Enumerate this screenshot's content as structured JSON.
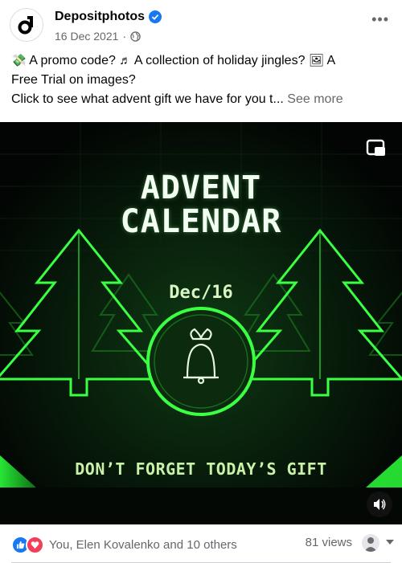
{
  "post": {
    "author": "Depositphotos",
    "date": "16 Dec 2021",
    "more_label": "•••",
    "caption": {
      "line1_a": "A promo code?",
      "line1_b": "A collection of holiday jingles?",
      "line1_c": "A",
      "line2": "Free Trial on images?",
      "line3": "Click to see what advent gift we have for you t...",
      "see_more": "See more"
    }
  },
  "media": {
    "title_line1": "ADVENT",
    "title_line2": "CALENDAR",
    "date_label": "Dec/16",
    "cta": "DON’T FORGET TODAY’S GIFT"
  },
  "footer": {
    "reactions_text": "You, Elen Kovalenko and 10 others",
    "views_text": "81 views"
  },
  "colors": {
    "accent": "#1877f2",
    "love": "#f33e58",
    "neon_green": "#39e639",
    "background_dark": "#050a06"
  },
  "icons": [
    "depositphotos-logo-icon",
    "verified-badge-icon",
    "globe-icon",
    "money-emoji-icon",
    "music-note-emoji-icon",
    "picture-emoji-icon",
    "pip-icon",
    "volume-icon",
    "like-icon",
    "love-icon",
    "bell-icon",
    "chevron-down-icon"
  ]
}
